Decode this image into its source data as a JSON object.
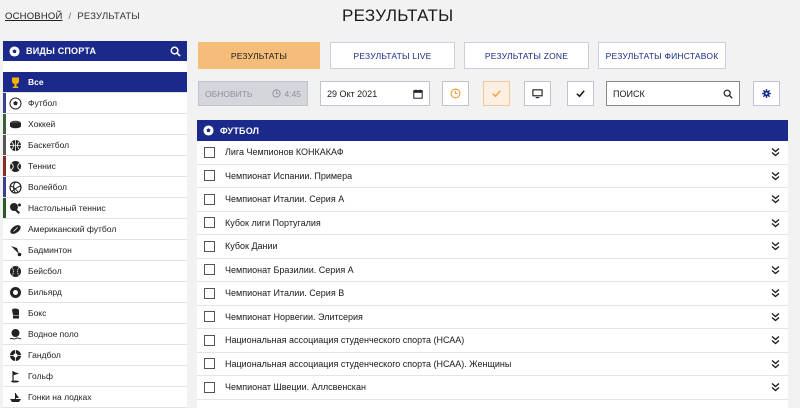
{
  "breadcrumb": {
    "home": "ОСНОВНОЙ",
    "separator": "/",
    "current": "РЕЗУЛЬТАТЫ"
  },
  "page_title": "РЕЗУЛЬТАТЫ",
  "sidebar": {
    "title": "ВИДЫ СПОРТА",
    "items": [
      {
        "label": "Все",
        "icon": "trophy-icon",
        "active": true
      },
      {
        "label": "Футбол",
        "icon": "soccer-ball-icon",
        "stripe": "#3a3f8f"
      },
      {
        "label": "Хоккей",
        "icon": "hockey-puck-icon",
        "stripe": "#3a5f3a"
      },
      {
        "label": "Баскетбол",
        "icon": "basketball-icon",
        "stripe": "#555555"
      },
      {
        "label": "Теннис",
        "icon": "tennis-ball-icon",
        "stripe": "#8a2a2a"
      },
      {
        "label": "Волейбол",
        "icon": "volleyball-icon",
        "stripe": "#3a3f8f"
      },
      {
        "label": "Настольный теннис",
        "icon": "table-tennis-icon",
        "stripe": "#2a5a2a"
      },
      {
        "label": "Американский футбол",
        "icon": "american-football-icon"
      },
      {
        "label": "Бадминтон",
        "icon": "shuttlecock-icon"
      },
      {
        "label": "Бейсбол",
        "icon": "baseball-icon"
      },
      {
        "label": "Бильярд",
        "icon": "billiard-ball-icon"
      },
      {
        "label": "Бокс",
        "icon": "boxing-glove-icon"
      },
      {
        "label": "Водное поло",
        "icon": "water-polo-icon"
      },
      {
        "label": "Гандбол",
        "icon": "handball-icon"
      },
      {
        "label": "Гольф",
        "icon": "golf-flag-icon"
      },
      {
        "label": "Гонки на лодках",
        "icon": "boat-icon"
      }
    ]
  },
  "tabs": [
    {
      "label": "РЕЗУЛЬТАТЫ",
      "active": true
    },
    {
      "label": "РЕЗУЛЬТАТЫ LIVE"
    },
    {
      "label": "РЕЗУЛЬТАТЫ ZONE"
    },
    {
      "label": "РЕЗУЛЬТАТЫ ФИНСТАВОК"
    }
  ],
  "toolbar": {
    "refresh_label": "ОБНОВИТЬ",
    "timer": "4:45",
    "date": "29 Окт 2021",
    "search_placeholder": "ПОИСК"
  },
  "results": {
    "section_title": "ФУТБОЛ",
    "leagues": [
      "Лига Чемпионов КОНКАКАФ",
      "Чемпионат Испании. Примера",
      "Чемпионат Италии. Серия A",
      "Кубок лиги Португалия",
      "Кубок Дании",
      "Чемпионат Бразилии. Серия A",
      "Чемпионат Италии. Серия B",
      "Чемпионат Норвегии. Элитсерия",
      "Национальная ассоциация студенческого спорта (НСАА)",
      "Национальная ассоциация студенческого спорта (НСАА). Женщины",
      "Чемпионат Швеции. Аллсвенскан"
    ]
  },
  "colors": {
    "brand": "#1b2a8a",
    "accent": "#f5bd79",
    "accent_orange": "#f0a040"
  }
}
